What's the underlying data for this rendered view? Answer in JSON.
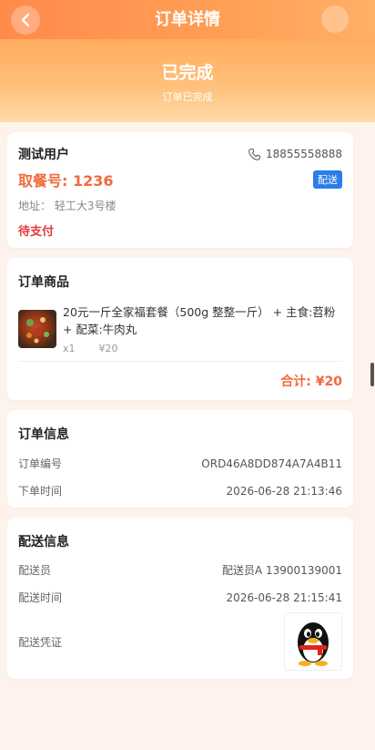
{
  "header": {
    "title": "订单详情"
  },
  "status": {
    "title": "已完成",
    "subtitle": "订单已完成"
  },
  "customer": {
    "name": "测试用户",
    "phone": "18855558888",
    "pickup_number": "取餐号: 1236",
    "delivery_badge": "配送",
    "address": "地址：  轻工大3号楼",
    "payment_status": "待支付"
  },
  "goods": {
    "title": "订单商品",
    "item": {
      "name": "20元一斤全家福套餐（500g 整整一斤） + 主食:苕粉 + 配菜:牛肉丸",
      "qty": "x1",
      "price": "¥20"
    },
    "total": "合计: ¥20"
  },
  "order_info": {
    "title": "订单信息",
    "number_label": "订单编号",
    "number_value": "ORD46A8DD874A7A4B11",
    "time_label": "下单时间",
    "time_value": "2026-06-28 21:13:46"
  },
  "delivery_info": {
    "title": "配送信息",
    "courier_label": "配送员",
    "courier_value": "配送员A 13900139001",
    "time_label": "配送时间",
    "time_value": "2026-06-28 21:15:41",
    "proof_label": "配送凭证"
  },
  "colors": {
    "accent": "#f06a3d",
    "badge": "#2b7de9",
    "unpaid": "#e03b3b"
  }
}
